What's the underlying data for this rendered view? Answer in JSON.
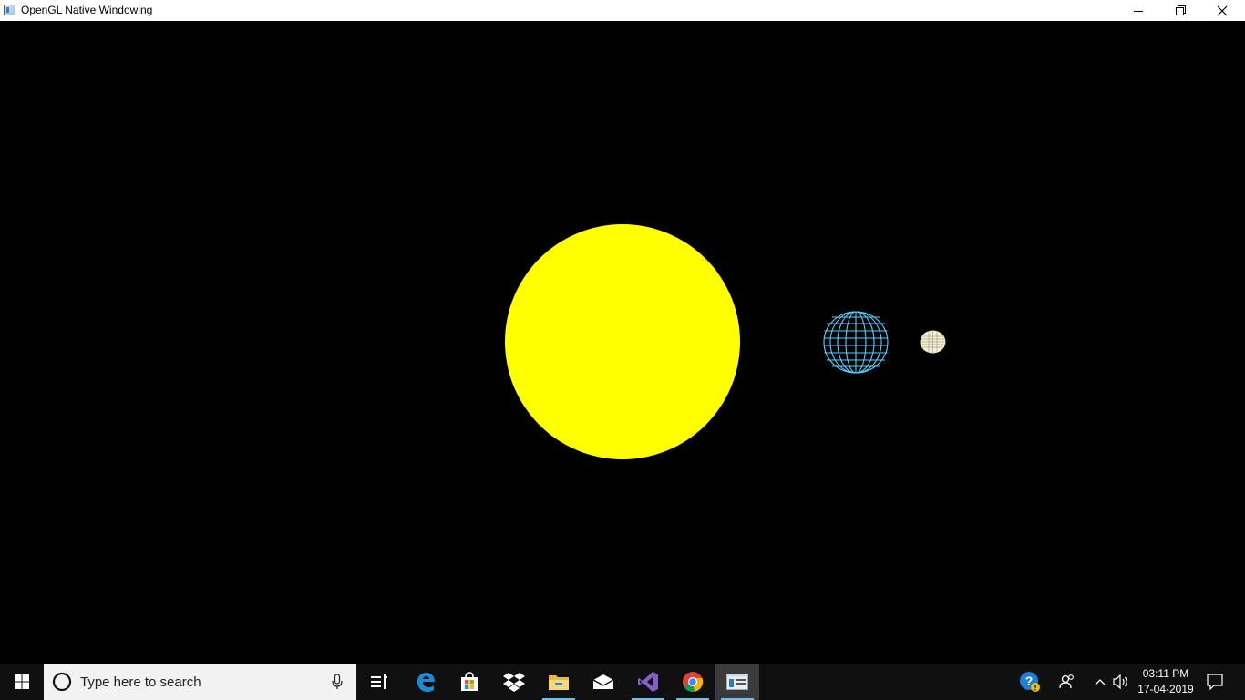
{
  "window": {
    "title": "OpenGL Native Windowing",
    "icon": "app-window-icon",
    "controls": [
      "minimize-icon",
      "restore-icon",
      "close-icon"
    ]
  },
  "scene": {
    "background": "#000000",
    "sun_color": "#ffff00",
    "earth_color": "#4fd1ff",
    "moon_color": "#f3efcf"
  },
  "taskbar": {
    "search_placeholder": "Type here to search",
    "pinned": [
      "task-view-icon",
      "edge-icon",
      "store-icon",
      "dropbox-icon",
      "file-explorer-icon",
      "mail-icon",
      "visual-studio-icon",
      "chrome-icon",
      "opengl-app-icon"
    ],
    "tray": [
      "help-icon",
      "people-icon",
      "chevron-up-icon",
      "volume-icon",
      "notifications-icon"
    ],
    "time": "03:11 PM",
    "date": "17-04-2019"
  }
}
